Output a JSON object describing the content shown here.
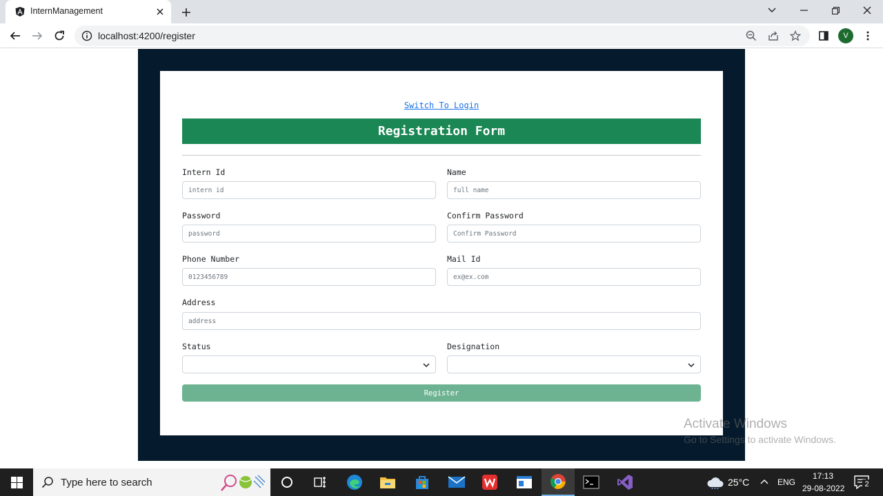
{
  "browser": {
    "tab_title": "InternManagement",
    "url": "localhost:4200/register",
    "profile_initial": "V"
  },
  "form": {
    "switch_link": "Switch To Login",
    "title": "Registration Form",
    "fields": {
      "intern_id": {
        "label": "Intern Id",
        "placeholder": "intern id"
      },
      "name": {
        "label": "Name",
        "placeholder": "full name"
      },
      "password": {
        "label": "Password",
        "placeholder": "password"
      },
      "confirm_password": {
        "label": "Confirm Password",
        "placeholder": "Confirm Password"
      },
      "phone": {
        "label": "Phone Number",
        "placeholder": "0123456789"
      },
      "mail": {
        "label": "Mail Id",
        "placeholder": "ex@ex.com"
      },
      "address": {
        "label": "Address",
        "placeholder": "address"
      },
      "status": {
        "label": "Status",
        "value": ""
      },
      "designation": {
        "label": "Designation",
        "value": ""
      }
    },
    "register_label": "Register",
    "colors": {
      "header": "#1b8754",
      "button": "#6db391",
      "page_bg": "#051a2c"
    }
  },
  "watermark": {
    "title": "Activate Windows",
    "subtitle": "Go to Settings to activate Windows."
  },
  "taskbar": {
    "search_placeholder": "Type here to search",
    "temperature": "25°C",
    "language": "ENG",
    "time": "17:13",
    "date": "29-08-2022",
    "notification_count": "2"
  }
}
